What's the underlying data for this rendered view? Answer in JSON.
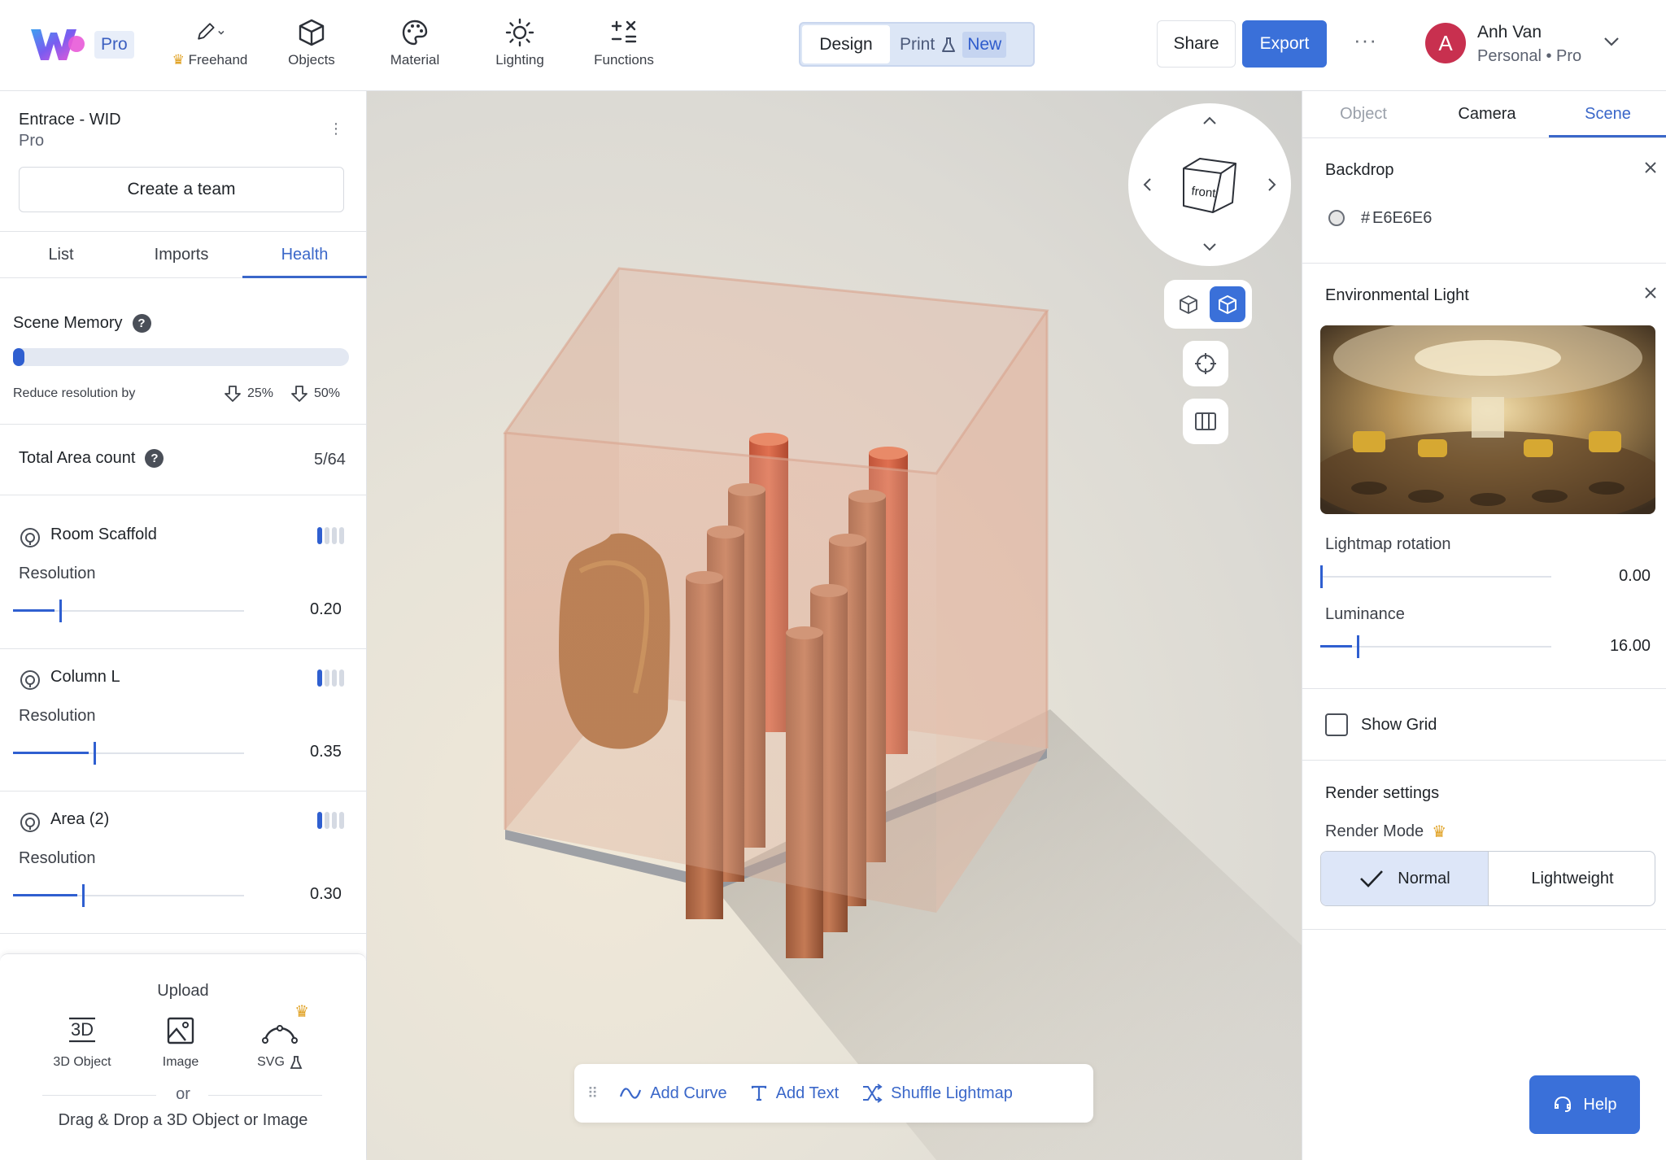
{
  "app": {
    "badge": "Pro",
    "icons": {
      "logo": "w-logo"
    }
  },
  "toolbar": {
    "tools": [
      {
        "label": "Freehand",
        "icon": "pencil-icon",
        "premium": true
      },
      {
        "label": "Objects",
        "icon": "cube-icon"
      },
      {
        "label": "Material",
        "icon": "palette-icon"
      },
      {
        "label": "Lighting",
        "icon": "sun-icon"
      },
      {
        "label": "Functions",
        "icon": "functions-icon"
      }
    ],
    "mode_design": "Design",
    "mode_print": "Print",
    "mode_print_badge": "New",
    "share": "Share",
    "export": "Export",
    "more": "···"
  },
  "user": {
    "initial": "A",
    "name": "Anh Van",
    "plan": "Personal • Pro",
    "avatar_color": "#c8304f"
  },
  "left_panel": {
    "project_title": "Entrace - WID",
    "project_plan": "Pro",
    "create_team": "Create a team",
    "tabs": [
      "List",
      "Imports",
      "Health"
    ],
    "active_tab": "Health",
    "scene_memory": {
      "title": "Scene Memory",
      "help": "?",
      "usage_fraction": 0.03,
      "reduce_label": "Reduce resolution by",
      "options": [
        "25%",
        "50%"
      ]
    },
    "total_area": {
      "title": "Total Area count",
      "help": "?",
      "count": "5/64"
    },
    "rooms": [
      {
        "name": "Room Scaffold",
        "res_label": "Resolution",
        "value": "0.20",
        "fraction": 0.2
      },
      {
        "name": "Column L",
        "res_label": "Resolution",
        "value": "0.35",
        "fraction": 0.35
      },
      {
        "name": "Area (2)",
        "res_label": "Resolution",
        "value": "0.30",
        "fraction": 0.3
      }
    ],
    "upload": {
      "title": "Upload",
      "items": [
        {
          "label": "3D Object",
          "icon": "3d-object-icon"
        },
        {
          "label": "Image",
          "icon": "image-icon"
        },
        {
          "label": "SVG",
          "icon": "svg-curve-icon"
        }
      ],
      "or": "or",
      "drag_drop": "Drag & Drop a 3D Object or Image"
    }
  },
  "viewport": {
    "nav_cube_face": "front",
    "bottom_toolbar": [
      "Add Curve",
      "Add Text",
      "Shuffle Lightmap"
    ]
  },
  "right_panel": {
    "tabs": [
      "Object",
      "Camera",
      "Scene"
    ],
    "active_tab": "Scene",
    "backdrop": {
      "title": "Backdrop",
      "hash": "#",
      "value": "E6E6E6",
      "color": "#E6E6E6"
    },
    "environment": {
      "title": "Environmental Light",
      "lightmap_rotation_label": "Lightmap rotation",
      "lightmap_rotation": "0.00",
      "lightmap_rotation_fraction": 0.0,
      "luminance_label": "Luminance",
      "luminance": "16.00",
      "luminance_fraction": 0.16
    },
    "show_grid": "Show Grid",
    "show_grid_checked": false,
    "render": {
      "title": "Render settings",
      "mode_label": "Render Mode",
      "options": [
        "Normal",
        "Lightweight"
      ],
      "selected": "Normal"
    },
    "help": "Help"
  },
  "colors": {
    "accent": "#3a70d9",
    "active_tab": "#3a67c9",
    "crown": "#e0a020"
  }
}
